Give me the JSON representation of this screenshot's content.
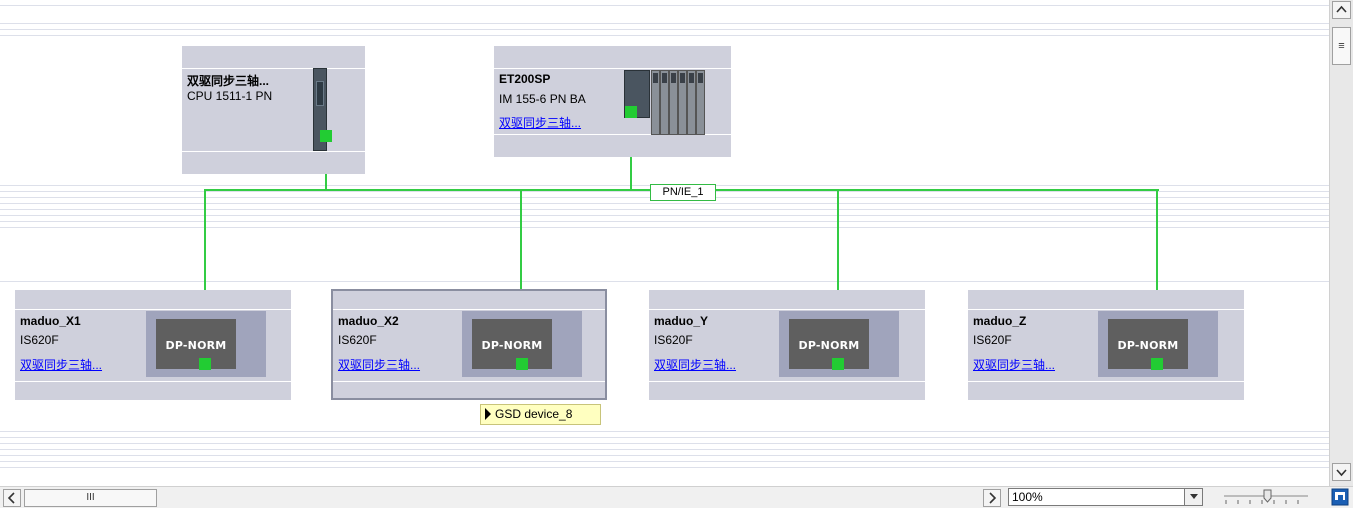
{
  "devices": {
    "plc": {
      "name": "双驱同步三轴...",
      "model": "CPU 1511-1 PN"
    },
    "et200": {
      "name": "ET200SP",
      "model": "IM 155-6 PN BA",
      "link": "双驱同步三轴..."
    },
    "drives": [
      {
        "name": "maduo_X1",
        "model": "IS620F",
        "link": "双驱同步三轴...",
        "module": "DP-NORM"
      },
      {
        "name": "maduo_X2",
        "model": "IS620F",
        "link": "双驱同步三轴...",
        "module": "DP-NORM"
      },
      {
        "name": "maduo_Y",
        "model": "IS620F",
        "link": "双驱同步三轴...",
        "module": "DP-NORM"
      },
      {
        "name": "maduo_Z",
        "model": "IS620F",
        "link": "双驱同步三轴...",
        "module": "DP-NORM"
      }
    ]
  },
  "network": {
    "label": "PN/IE_1",
    "color": "#33cc44"
  },
  "tooltip": {
    "text": "GSD device_8"
  },
  "toolbar": {
    "zoom_value": "100%",
    "scroll_left": "<",
    "scroll_right": ">",
    "scroll_up": "^",
    "scroll_down": "v",
    "hscroll_grip": "III",
    "vscroll_grip": "≡"
  },
  "icons": {
    "scroll_up": "chevron-up-icon",
    "scroll_down": "chevron-down-icon",
    "scroll_left": "chevron-left-icon",
    "scroll_right": "chevron-right-icon",
    "overview": "overview-navigation-icon"
  }
}
